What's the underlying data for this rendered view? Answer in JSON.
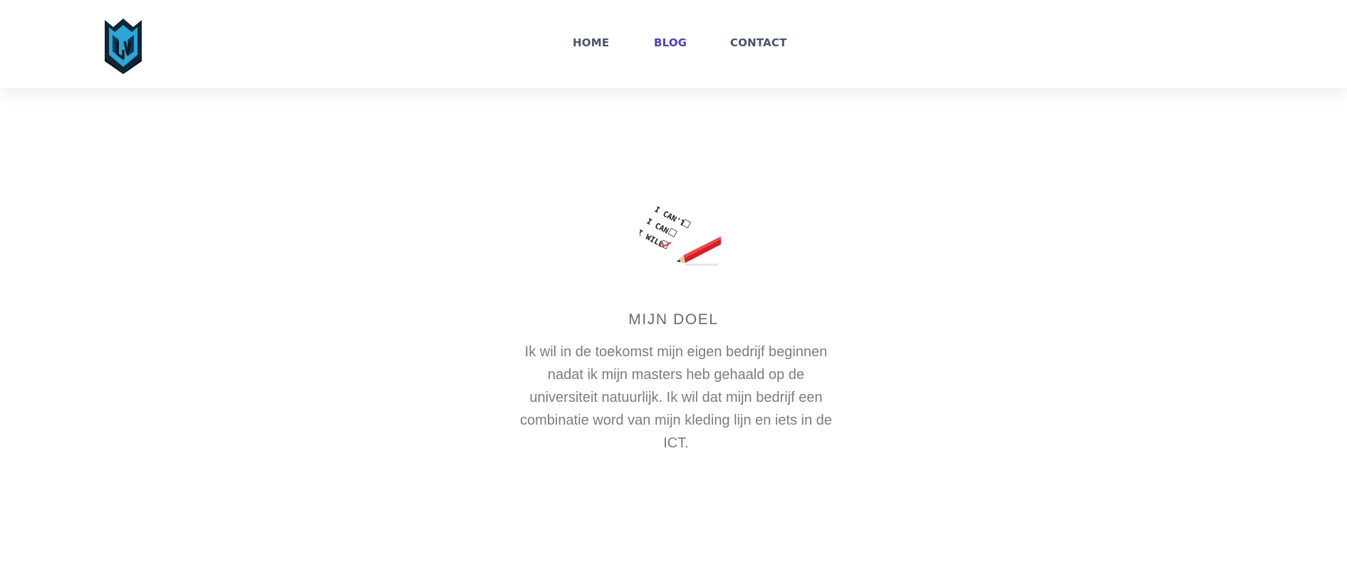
{
  "header": {
    "logo_icon": "shield-logo-icon",
    "nav": {
      "home_label": "HOME",
      "blog_label": "BLOG",
      "contact_label": "CONTACT"
    },
    "active_item": "BLOG",
    "active_color": "#4b3fc2",
    "nav_color": "#475569"
  },
  "main": {
    "image_words": [
      "I CAN'T",
      "I CAN",
      "I WILL"
    ],
    "title": "MIJN DOEL",
    "paragraph": "Ik wil in de toekomst mijn eigen bedrijf beginnen nadat ik mijn masters heb gehaald op de universiteit natuurlijk. Ik wil dat mijn bedrijf een combinatie word van mijn kleding lijn en iets in de ICT."
  }
}
